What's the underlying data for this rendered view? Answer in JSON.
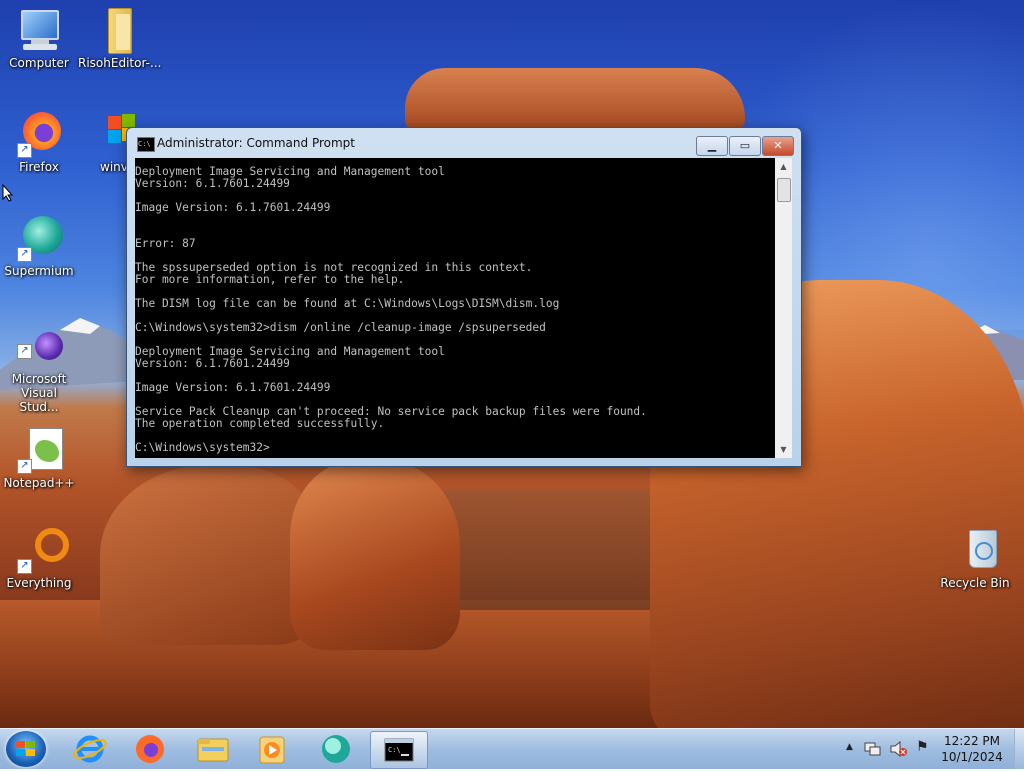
{
  "desktop": {
    "icons": [
      {
        "label": "Computer"
      },
      {
        "label": "RisohEditor-..."
      },
      {
        "label": "Firefox"
      },
      {
        "label": "winv"
      },
      {
        "label": "Supermium"
      },
      {
        "label": "Microsoft Visual Stud..."
      },
      {
        "label": "Notepad++"
      },
      {
        "label": "Everything"
      },
      {
        "label": "Recycle Bin"
      }
    ]
  },
  "window": {
    "title": "Administrator: Command Prompt",
    "buttons": {
      "minimize": "▁",
      "maximize": "▭",
      "close": "✕"
    },
    "console_text": "Deployment Image Servicing and Management tool\nVersion: 6.1.7601.24499\n\nImage Version: 6.1.7601.24499\n\n\nError: 87\n\nThe spssuperseded option is not recognized in this context.\nFor more information, refer to the help.\n\nThe DISM log file can be found at C:\\Windows\\Logs\\DISM\\dism.log\n\nC:\\Windows\\system32>dism /online /cleanup-image /spsuperseded\n\nDeployment Image Servicing and Management tool\nVersion: 6.1.7601.24499\n\nImage Version: 6.1.7601.24499\n\nService Pack Cleanup can't proceed: No service pack backup files were found.\nThe operation completed successfully.\n\nC:\\Windows\\system32>"
  },
  "taskbar": {
    "pinned": [
      "internet-explorer-icon",
      "firefox-icon",
      "file-explorer-icon",
      "media-player-icon",
      "supermium-icon",
      "command-prompt-icon"
    ],
    "tray": {
      "up_arrow": "▲",
      "flag": "⚑"
    },
    "clock": {
      "time": "12:22 PM",
      "date": "10/1/2024"
    }
  }
}
